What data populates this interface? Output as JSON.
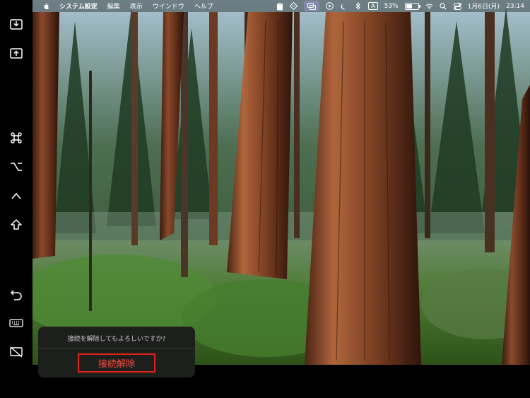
{
  "sidebar": {
    "buttons": [
      {
        "name": "tray-download-icon"
      },
      {
        "name": "tray-upload-icon"
      },
      {
        "name": "command-key-icon"
      },
      {
        "name": "option-key-icon"
      },
      {
        "name": "control-key-icon"
      },
      {
        "name": "shift-key-icon"
      },
      {
        "name": "undo-icon"
      },
      {
        "name": "keyboard-icon"
      },
      {
        "name": "disconnect-display-icon"
      }
    ]
  },
  "menubar": {
    "app_name": "システム設定",
    "menus": [
      "編集",
      "表示",
      "ウインドウ",
      "ヘルプ"
    ],
    "input_indicator": "A",
    "battery_percent": "53%",
    "battery_level": 0.53,
    "date": "1月6日(月)",
    "time": "23:14"
  },
  "popup": {
    "message": "接続を解除してもよろしいですか?",
    "disconnect_label": "接続解除",
    "accent_color": "#e0221b"
  }
}
